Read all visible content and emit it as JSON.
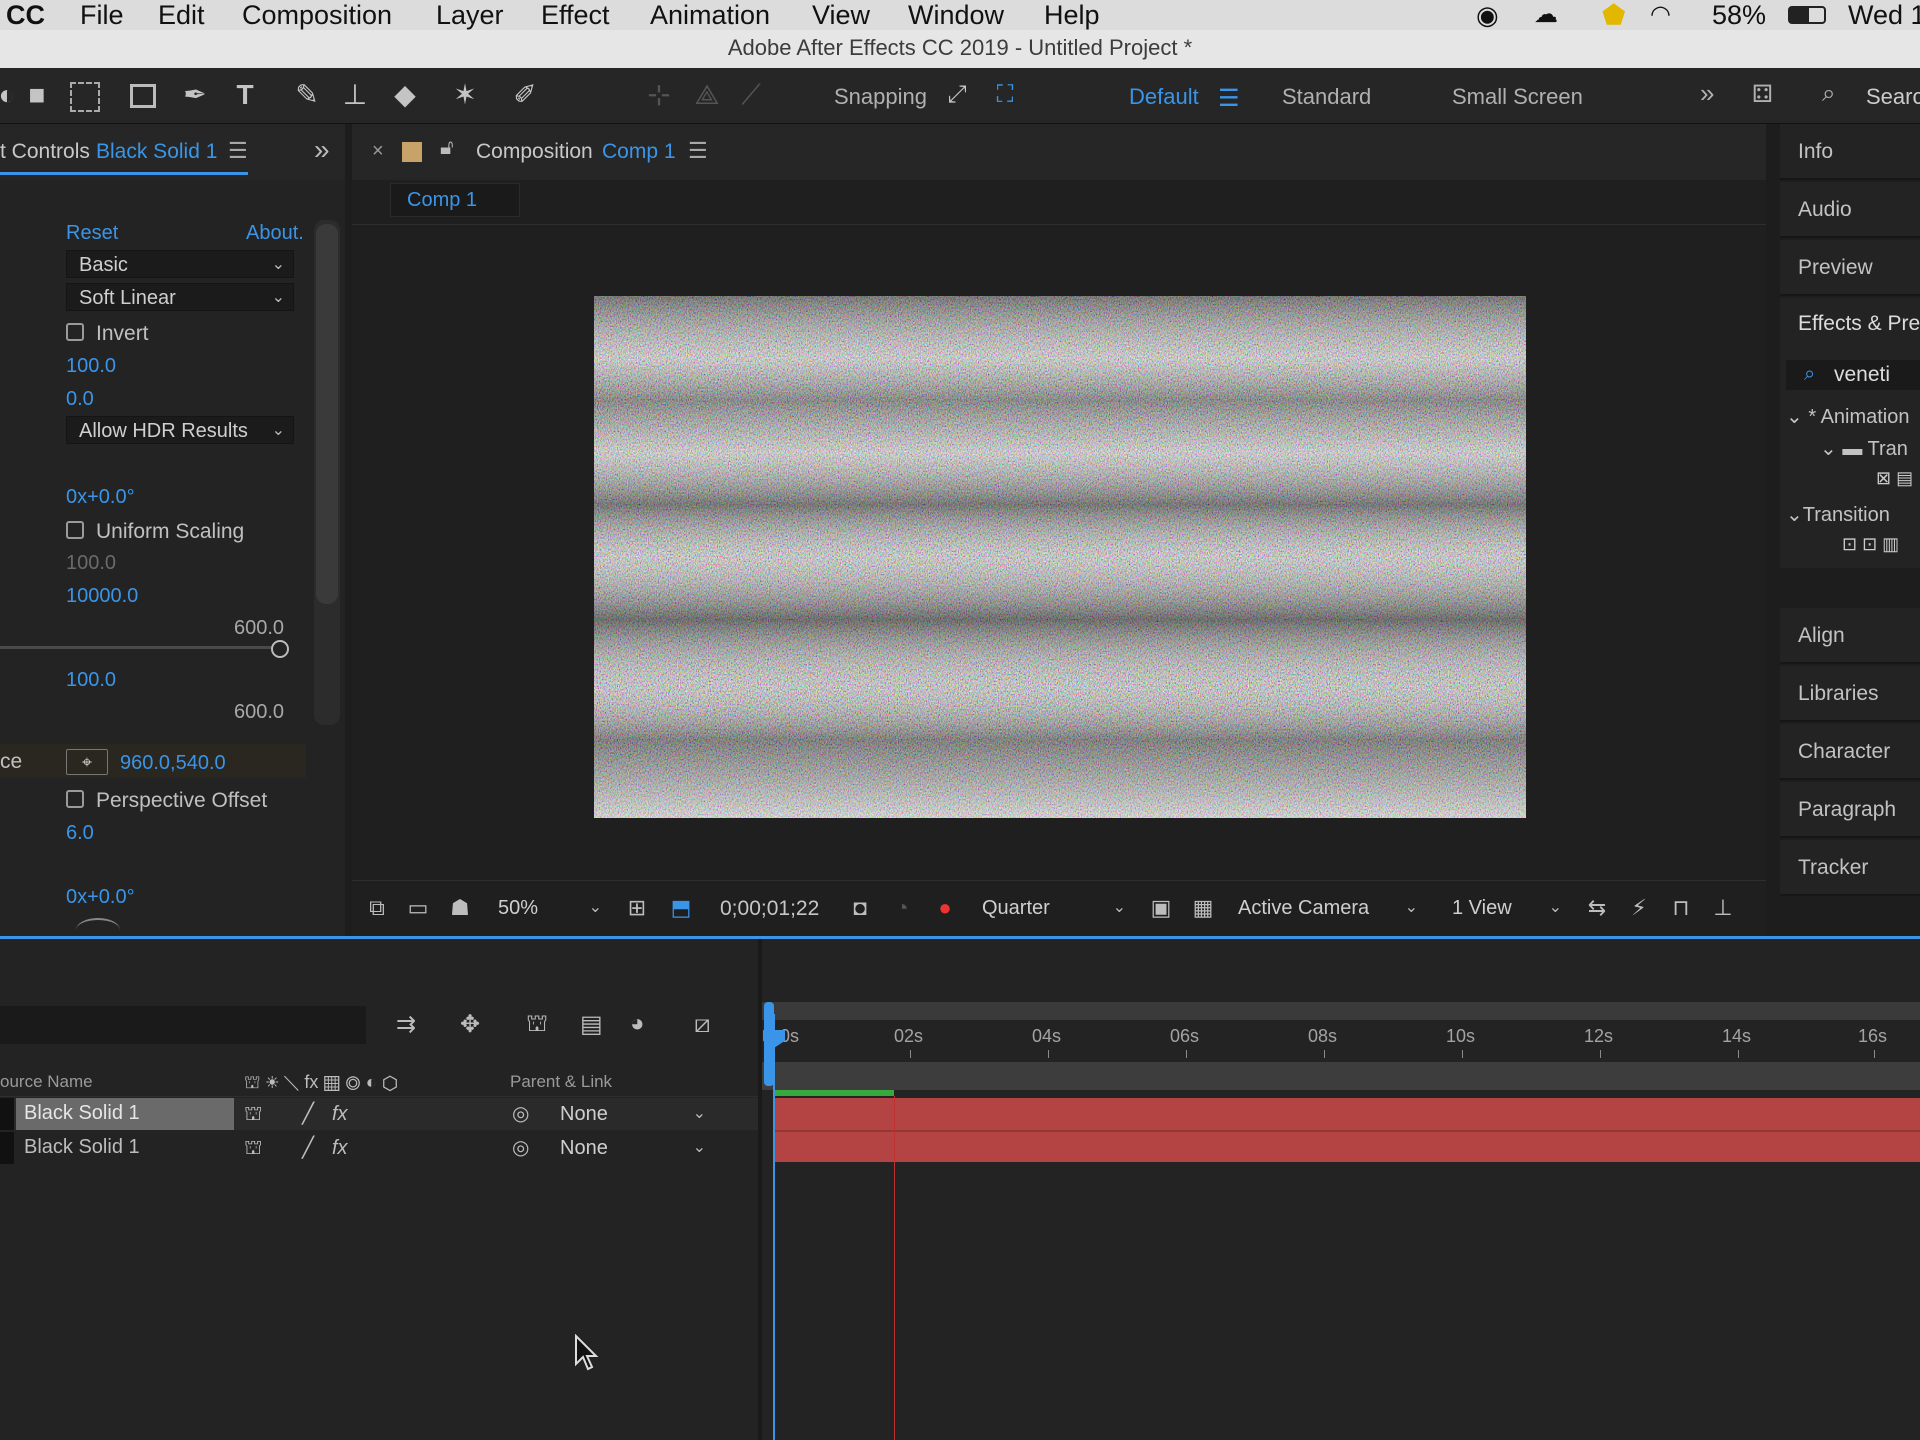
{
  "menubar": {
    "app": "CC",
    "items": [
      "File",
      "Edit",
      "Composition",
      "Layer",
      "Effect",
      "Animation",
      "View",
      "Window",
      "Help"
    ],
    "battery": "58%",
    "day": "Wed 1"
  },
  "window_title": "Adobe After Effects CC 2019 - Untitled Project *",
  "toolbar": {
    "snapping": "Snapping",
    "workspaces": [
      "Default",
      "Standard",
      "Small Screen"
    ],
    "search_label": "Searc"
  },
  "effect_controls": {
    "header_prefix": "t Controls",
    "header_layer": "Black Solid 1",
    "reset": "Reset",
    "about": "About.",
    "basic": "Basic",
    "soft_linear": "Soft Linear",
    "invert": "Invert",
    "v100": "100.0",
    "v0": "0.0",
    "allow_hdr": "Allow HDR Results",
    "rot1": "0x+0.0°",
    "uniform_scaling": "Uniform Scaling",
    "v100_dim": "100.0",
    "v10000": "10000.0",
    "v600a": "600.0",
    "v100b": "100.0",
    "v600b": "600.0",
    "center_label": "ce",
    "center_value": "960.0,540.0",
    "perspective_offset": "Perspective Offset",
    "v6": "6.0",
    "rot2": "0x+0.0°"
  },
  "composition": {
    "header_prefix": "Composition",
    "header_name": "Comp 1",
    "tab": "Comp 1",
    "zoom": "50%",
    "timecode": "0;00;01;22",
    "resolution": "Quarter",
    "camera": "Active Camera",
    "view": "1 View"
  },
  "right_panels": {
    "tabs_top": [
      "Info",
      "Audio",
      "Preview"
    ],
    "effects_title": "Effects & Pre",
    "search_value": "veneti",
    "tree": [
      "* Animation",
      "Tran",
      "Transition"
    ],
    "tabs_bottom": [
      "Align",
      "Libraries",
      "Character",
      "Paragraph",
      "Tracker"
    ]
  },
  "timeline": {
    "col_source": "ource Name",
    "col_parent": "Parent & Link",
    "ticks": [
      "0s",
      "02s",
      "04s",
      "06s",
      "08s",
      "10s",
      "12s",
      "14s",
      "16s"
    ],
    "layers": [
      {
        "name": "Black Solid 1",
        "parent": "None"
      },
      {
        "name": "Black Solid 1",
        "parent": "None"
      }
    ]
  }
}
